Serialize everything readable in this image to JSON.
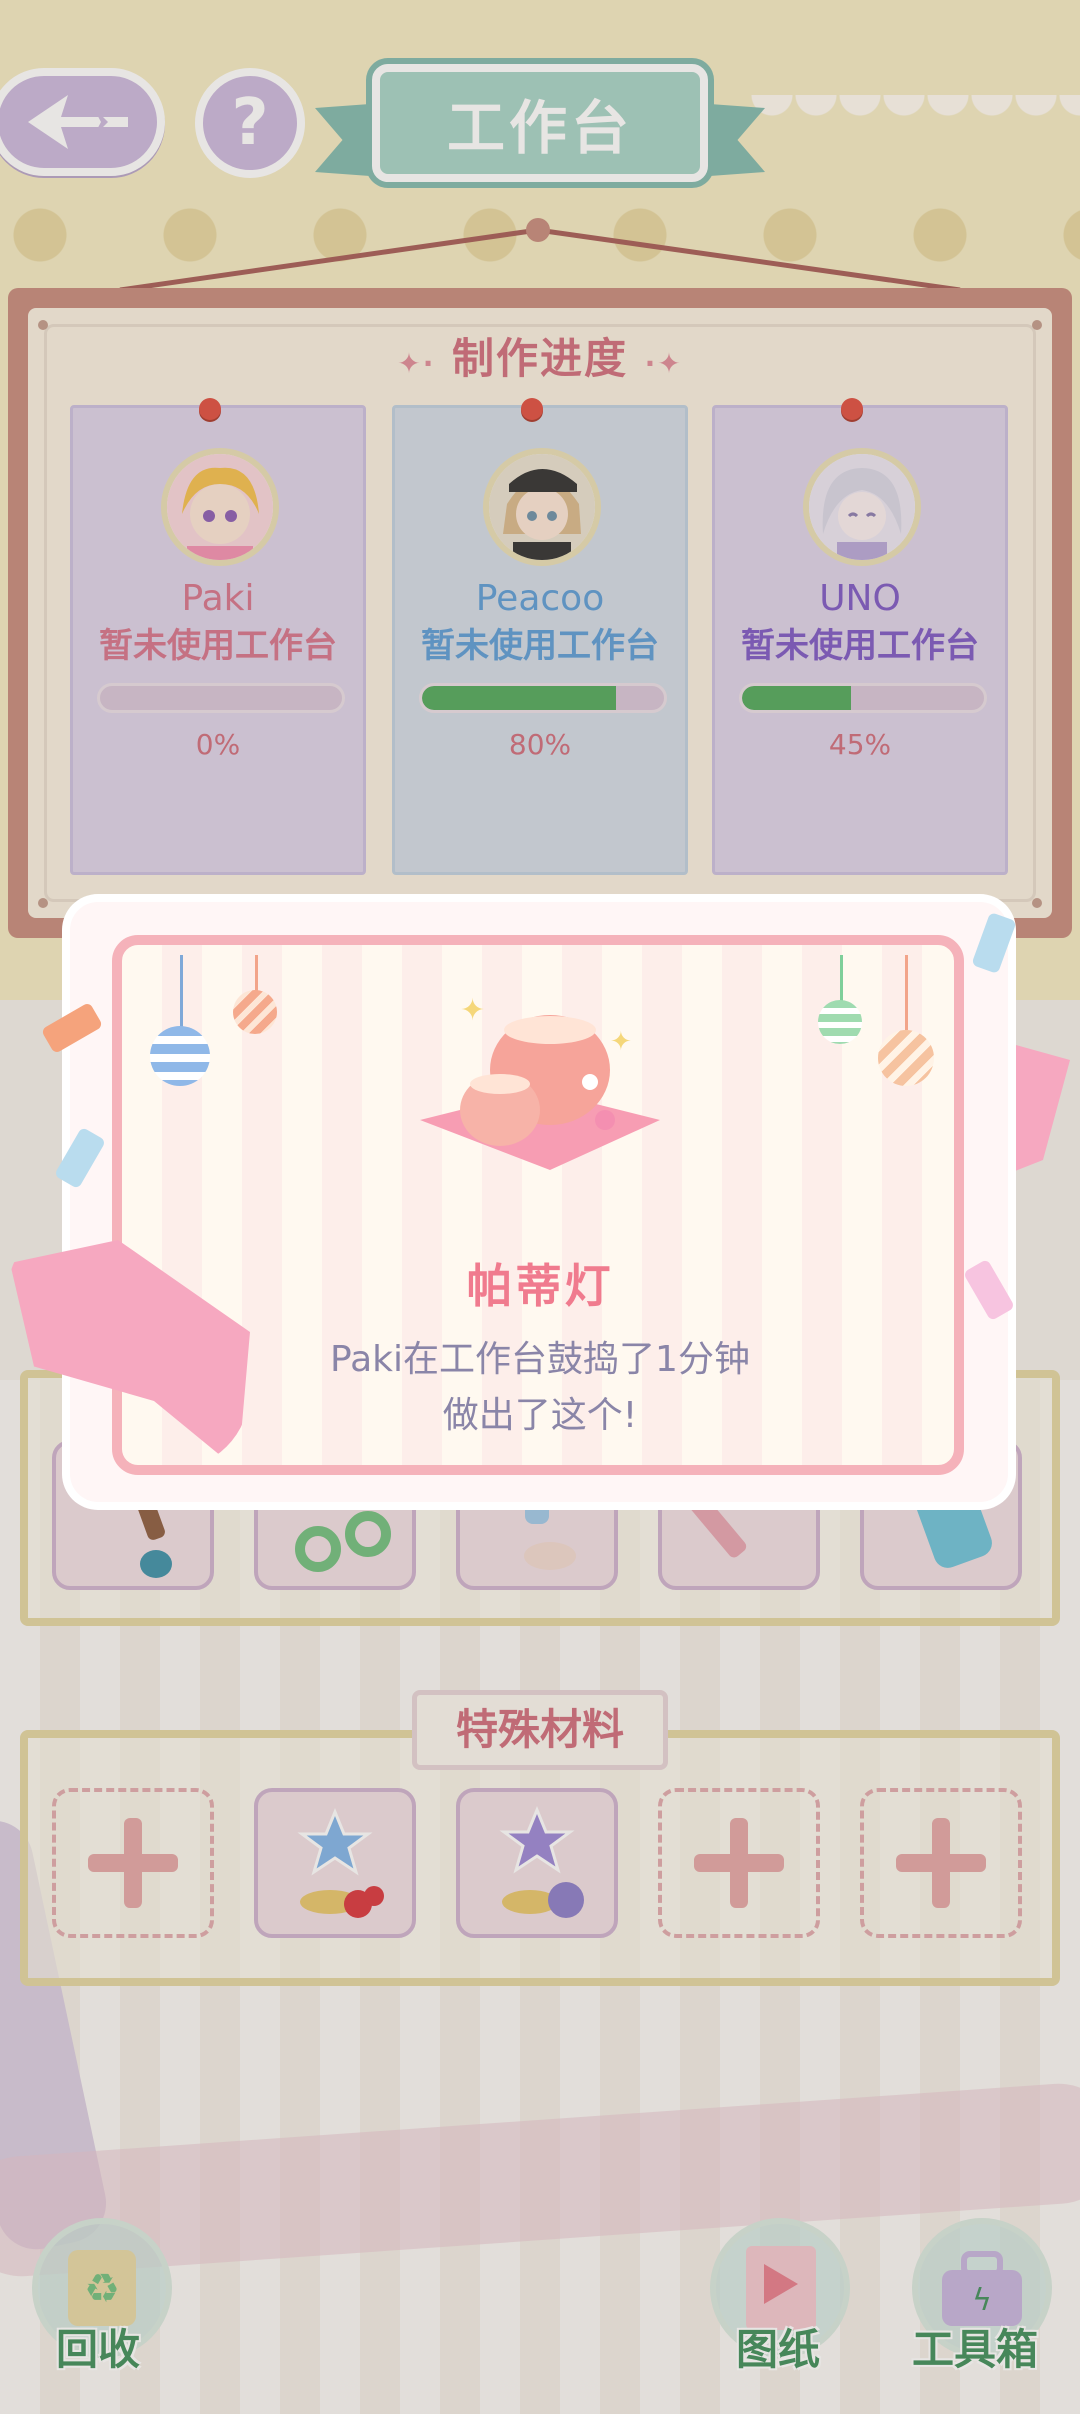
{
  "header": {
    "title": "工作台"
  },
  "progress": {
    "title": "制作进度",
    "workers": [
      {
        "name": "Paki",
        "status": "暂未使用工作台",
        "progress": 0,
        "percent_label": "0%",
        "card_color": "#ddd2e8",
        "text_color": "#d6728a",
        "status_color": "#d6728a"
      },
      {
        "name": "Peacoo",
        "status": "暂未使用工作台",
        "progress": 0.8,
        "percent_label": "80%",
        "card_color": "#d2dbe6",
        "text_color": "#5a9bd6",
        "status_color": "#5a9bd6"
      },
      {
        "name": "UNO",
        "status": "暂未使用工作台",
        "progress": 0.45,
        "percent_label": "45%",
        "card_color": "#ddd2e8",
        "text_color": "#7c56c4",
        "status_color": "#7c56c4"
      }
    ]
  },
  "materials": {
    "title": "特殊材料",
    "slots": [
      "empty",
      "blue-star-flower-material",
      "purple-star-cat-material",
      "empty",
      "empty"
    ]
  },
  "tools": {
    "slots": [
      "brush-tool",
      "scissors-tool",
      "paint-brush-tool",
      "cutter-tool",
      "glue-bottle-tool"
    ]
  },
  "popup": {
    "item_name": "帕蒂灯",
    "line1": "Paki在工作台鼓捣了1分钟",
    "line2": "做出了这个!",
    "item_icon": "party-lamp-icon"
  },
  "bottom_bar": {
    "recycle": "回收",
    "blueprint": "图纸",
    "toolbox": "工具箱"
  }
}
